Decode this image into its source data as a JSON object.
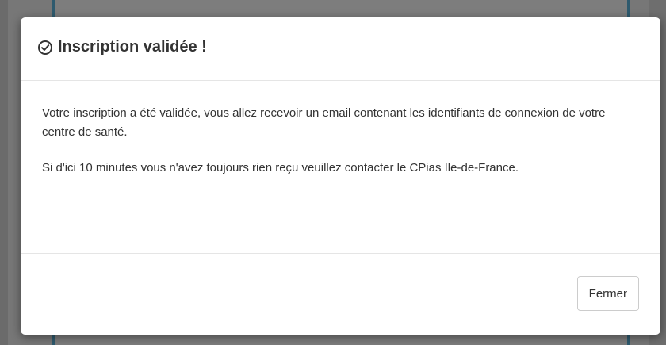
{
  "modal": {
    "title": "Inscription validée !",
    "title_icon": "check-circle-icon",
    "body": {
      "paragraph1": "Votre inscription a été validée, vous allez recevoir un email contenant les identifiants de connexion de votre centre de santé.",
      "paragraph2": "Si d'ici 10 minutes vous n'avez toujours rien reçu veuillez contacter le CPias Ile-de-France."
    },
    "footer": {
      "close_label": "Fermer"
    }
  },
  "colors": {
    "backdrop": "#777777",
    "modal_bg": "#ffffff",
    "text": "#333333",
    "divider": "#e5e5e5",
    "button_border": "#cccccc"
  }
}
